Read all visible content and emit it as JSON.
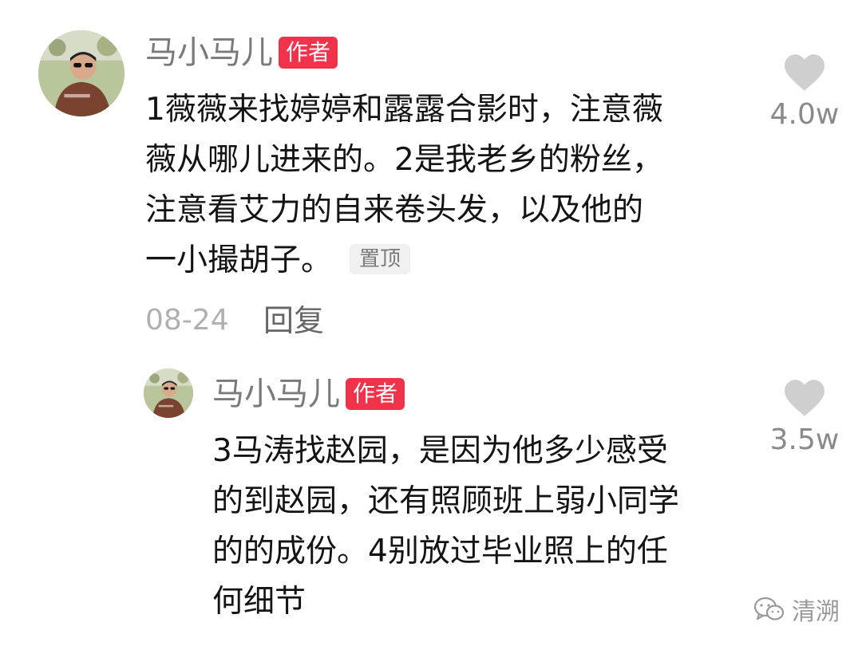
{
  "colors": {
    "badge": "#f0324b",
    "username": "#7a7a7a",
    "like_icon": "#cfcfcf",
    "date": "#b0b0b0"
  },
  "comment": {
    "username": "马小马儿",
    "badge": "作者",
    "lines": [
      "1薇薇来找婷婷和露露合影时，注意薇",
      "薇从哪儿进来的。2是我老乡的粉丝，",
      "注意看艾力的自来卷头发，以及他的",
      "一小撮胡子。"
    ],
    "pinned_label": "置顶",
    "date": "08-24",
    "reply_label": "回复",
    "like_icon": "heart-icon",
    "like_count": "4.0w"
  },
  "reply": {
    "username": "马小马儿",
    "badge": "作者",
    "lines": [
      "3马涛找赵园，是因为他多少感受",
      "的到赵园，还有照顾班上弱小同学",
      "的的成份。4别放过毕业照上的任",
      "何细节"
    ],
    "like_icon": "heart-icon",
    "like_count": "3.5w"
  },
  "watermark": {
    "icon": "wechat-icon",
    "text": "清溯"
  }
}
